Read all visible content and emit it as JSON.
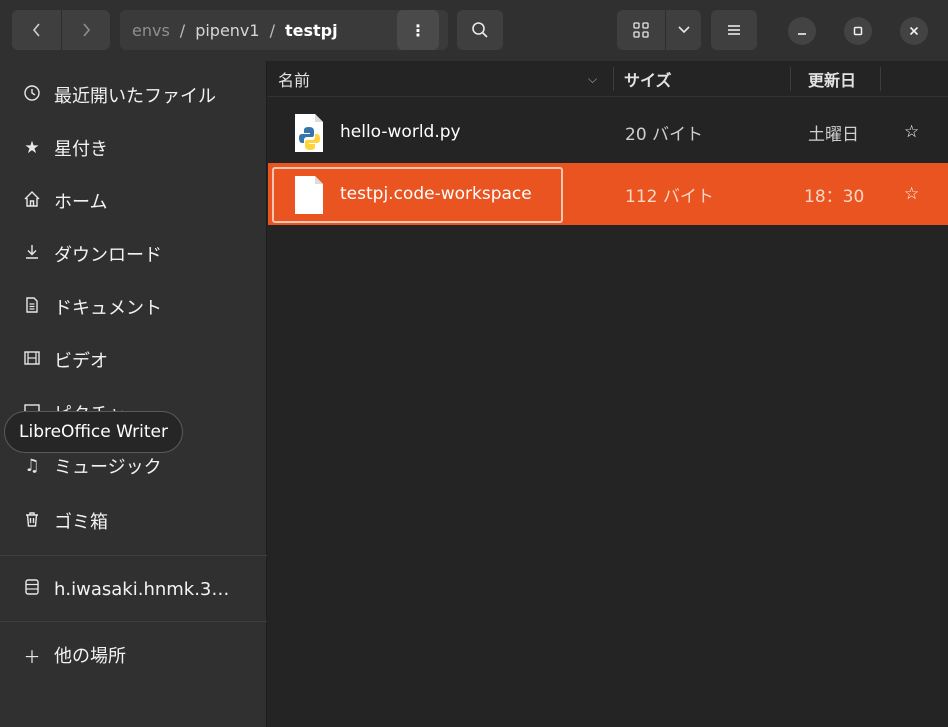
{
  "header": {
    "back_icon": "chevron-left-icon",
    "forward_icon": "chevron-right-icon",
    "breadcrumbs": [
      "envs",
      "pipenv1",
      "testpj"
    ],
    "path_menu_label": "⋮",
    "search_icon": "search-icon",
    "view_grid_icon": "grid-view-icon",
    "view_dropdown_icon": "chevron-down-icon",
    "main_menu_icon": "hamburger-menu-icon"
  },
  "sidebar": {
    "items": [
      {
        "label": "最近開いたファイル",
        "icon": "clock-icon"
      },
      {
        "label": "星付き",
        "icon": "star-icon"
      },
      {
        "label": "ホーム",
        "icon": "home-icon"
      },
      {
        "label": "ダウンロード",
        "icon": "download-icon"
      },
      {
        "label": "ドキュメント",
        "icon": "document-icon"
      },
      {
        "label": "ビデオ",
        "icon": "video-icon"
      },
      {
        "label": "ピクチャ",
        "icon": "picture-icon"
      },
      {
        "label": "ミュージック",
        "icon": "music-icon"
      },
      {
        "label": "ゴミ箱",
        "icon": "trash-icon"
      },
      {
        "label": "h.iwasaki.hnmk.3…",
        "icon": "drive-icon"
      },
      {
        "label": "他の場所",
        "icon": "plus-icon"
      }
    ],
    "tooltip": "LibreOffice Writer"
  },
  "columns": {
    "name": "名前",
    "size": "サイズ",
    "modified": "更新日"
  },
  "files": [
    {
      "name": "hello-world.py",
      "size": "20 バイト",
      "modified": "土曜日",
      "starred": false,
      "selected": false,
      "icon": "python-file-icon"
    },
    {
      "name": "testpj.code-workspace",
      "size": "112 バイト",
      "modified": "18：30",
      "starred": false,
      "selected": true,
      "icon": "text-file-icon"
    }
  ],
  "colors": {
    "accent": "#e95420",
    "background": "#242424",
    "sidebar": "#303030"
  }
}
